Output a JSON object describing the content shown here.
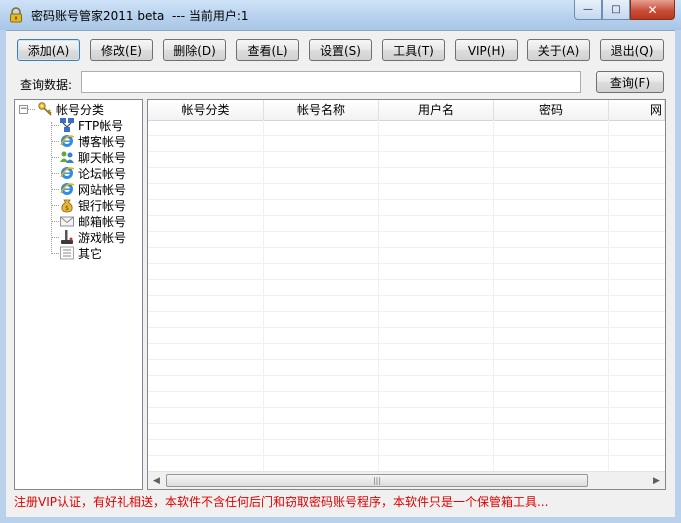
{
  "window": {
    "title": "密码账号管家2011 beta  --- 当前用户:1",
    "minimize_glyph": "—",
    "maximize_glyph": "□",
    "close_glyph": "✕"
  },
  "toolbar": {
    "add": "添加(A)",
    "edit": "修改(E)",
    "delete": "删除(D)",
    "view": "查看(L)",
    "settings": "设置(S)",
    "tools": "工具(T)",
    "vip": "VIP(H)",
    "about": "关于(A)",
    "exit": "退出(Q)"
  },
  "search": {
    "label": "查询数据:",
    "value": "",
    "button": "查询(F)"
  },
  "tree": {
    "expander": "−",
    "root": "帐号分类",
    "items": [
      {
        "label": "FTP帐号",
        "icon": "ftp-icon"
      },
      {
        "label": "博客帐号",
        "icon": "ie-blog-icon"
      },
      {
        "label": "聊天帐号",
        "icon": "chat-users-icon"
      },
      {
        "label": "论坛帐号",
        "icon": "ie-forum-icon"
      },
      {
        "label": "网站帐号",
        "icon": "ie-website-icon"
      },
      {
        "label": "银行帐号",
        "icon": "money-bag-icon"
      },
      {
        "label": "邮箱帐号",
        "icon": "mail-icon"
      },
      {
        "label": "游戏帐号",
        "icon": "joystick-icon"
      },
      {
        "label": "其它",
        "icon": "list-icon"
      }
    ]
  },
  "grid": {
    "columns": [
      "帐号分类",
      "帐号名称",
      "用户名",
      "密码",
      "网"
    ],
    "rows": []
  },
  "status": {
    "text": "注册VIP认证，有好礼相送，本软件不含任何后门和窃取密码账号程序，本软件只是一个保管箱工具..."
  },
  "colors": {
    "status_text": "#e00000",
    "title_bar": "#b9d3ee",
    "close_button": "#c7503a"
  }
}
